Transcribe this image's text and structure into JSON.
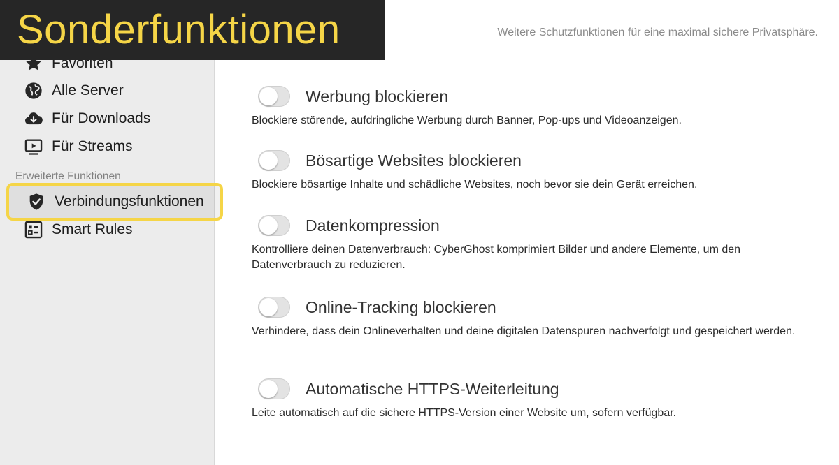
{
  "banner": {
    "title": "Sonderfunktionen"
  },
  "main": {
    "subtitle": "Weitere Schutzfunktionen für eine maximal sichere Privatsphäre."
  },
  "sidebar": {
    "items": [
      {
        "label": "Favoriten",
        "icon": "star-icon"
      },
      {
        "label": "Alle Server",
        "icon": "globe-icon"
      },
      {
        "label": "Für Downloads",
        "icon": "cloud-download-icon"
      },
      {
        "label": "Für Streams",
        "icon": "play-screen-icon"
      }
    ],
    "section_label": "Erweiterte Funktionen",
    "advanced_items": [
      {
        "label": "Verbindungsfunktionen",
        "icon": "shield-check-icon",
        "selected": true
      },
      {
        "label": "Smart Rules",
        "icon": "rules-list-icon"
      }
    ]
  },
  "features": [
    {
      "title": "Werbung blockieren",
      "description": "Blockiere störende, aufdringliche Werbung durch Banner, Pop-ups und Videoanzeigen.",
      "enabled": false
    },
    {
      "title": "Bösartige Websites blockieren",
      "description": "Blockiere bösartige Inhalte und schädliche Websites, noch bevor sie dein Gerät erreichen.",
      "enabled": false
    },
    {
      "title": "Datenkompression",
      "description": "Kontrolliere deinen Datenverbrauch: CyberGhost komprimiert Bilder und andere Elemente, um den Datenverbrauch zu reduzieren.",
      "enabled": false
    },
    {
      "title": "Online-Tracking blockieren",
      "description": "Verhindere, dass dein Onlineverhalten und deine digitalen Datenspuren nachverfolgt und gespeichert werden.",
      "enabled": false
    },
    {
      "title": "Automatische HTTPS-Weiterleitung",
      "description": "Leite automatisch auf die sichere HTTPS-Version einer Website um, sofern verfügbar.",
      "enabled": false
    }
  ],
  "colors": {
    "banner_bg": "#262626",
    "banner_text": "#f5d547",
    "highlight": "#f5d547",
    "sidebar_bg": "#ececec"
  }
}
